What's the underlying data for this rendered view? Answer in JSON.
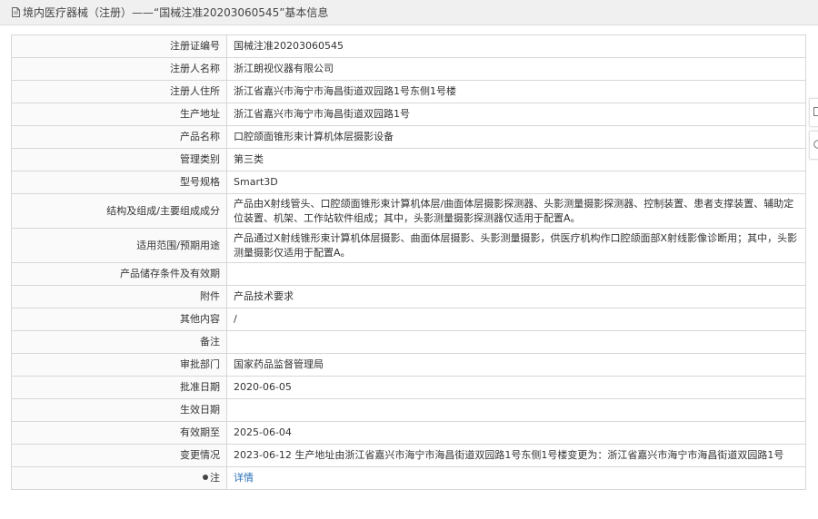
{
  "header": {
    "icon": "document-icon",
    "title": "境内医疗器械（注册）——“国械注准20203060545”基本信息"
  },
  "rows": [
    {
      "label": "注册证编号",
      "value": "国械注准20203060545"
    },
    {
      "label": "注册人名称",
      "value": "浙江朗视仪器有限公司"
    },
    {
      "label": "注册人住所",
      "value": "浙江省嘉兴市海宁市海昌街道双园路1号东侧1号楼"
    },
    {
      "label": "生产地址",
      "value": "浙江省嘉兴市海宁市海昌街道双园路1号"
    },
    {
      "label": "产品名称",
      "value": "口腔颌面锥形束计算机体层摄影设备"
    },
    {
      "label": "管理类别",
      "value": "第三类"
    },
    {
      "label": "型号规格",
      "value": "Smart3D"
    },
    {
      "label": "结构及组成/主要组成成分",
      "value": "产品由X射线管头、口腔颌面锥形束计算机体层/曲面体层摄影探测器、头影测量摄影探测器、控制装置、患者支撑装置、辅助定位装置、机架、工作站软件组成；其中，头影测量摄影探测器仅适用于配置A。"
    },
    {
      "label": "适用范围/预期用途",
      "value": "产品通过X射线锥形束计算机体层摄影、曲面体层摄影、头影测量摄影，供医疗机构作口腔颌面部X射线影像诊断用；其中，头影测量摄影仅适用于配置A。"
    },
    {
      "label": "产品储存条件及有效期",
      "value": ""
    },
    {
      "label": "附件",
      "value": "产品技术要求"
    },
    {
      "label": "其他内容",
      "value": "/"
    },
    {
      "label": "备注",
      "value": ""
    },
    {
      "label": "审批部门",
      "value": "国家药品监督管理局"
    },
    {
      "label": "批准日期",
      "value": "2020-06-05"
    },
    {
      "label": "生效日期",
      "value": ""
    },
    {
      "label": "有效期至",
      "value": "2025-06-04"
    },
    {
      "label": "变更情况",
      "value": "2023-06-12 生产地址由浙江省嘉兴市海宁市海昌街道双园路1号东侧1号楼变更为：浙江省嘉兴市海宁市海昌街道双园路1号"
    }
  ],
  "note": {
    "icon": "info-dot-icon",
    "label": "注",
    "link_text": "详情"
  },
  "side_buttons": [
    "document-icon",
    "info-icon"
  ]
}
